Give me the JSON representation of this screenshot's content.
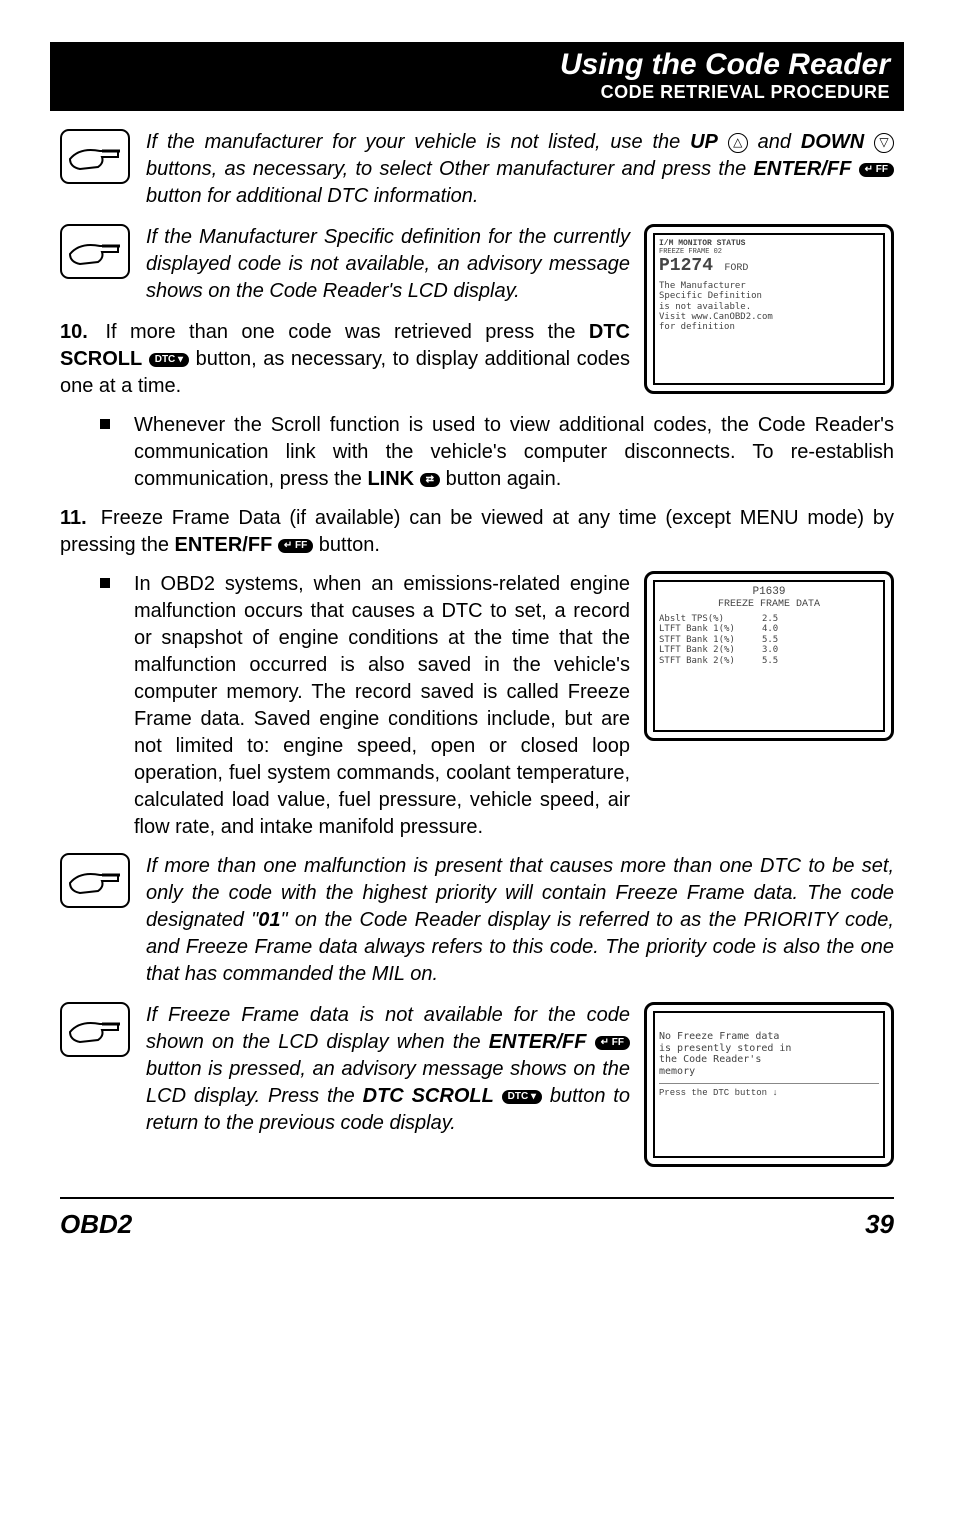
{
  "header": {
    "title": "Using the Code Reader",
    "subtitle": "CODE RETRIEVAL PROCEDURE"
  },
  "note1": {
    "pre": "If the manufacturer for your vehicle is not listed, use the ",
    "up": "UP",
    "and": " and ",
    "down": "DOWN",
    "mid": " buttons, as necessary, to select Other manufacturer and press the ",
    "enter": "ENTER/FF",
    "post": " button for additional DTC information."
  },
  "note2": "If the Manufacturer Specific definition for the currently displayed code is not available, an advisory message shows on the Code Reader's LCD display.",
  "screen1": {
    "top": "I/M MONITOR STATUS",
    "code": "P1274",
    "make": "FORD",
    "frame": "FREEZE FRAME 02",
    "msg": "The Manufacturer\nSpecific Definition\nis not available.\nVisit www.CanOBD2.com\nfor definition"
  },
  "item10": {
    "num": "10.",
    "pre": "If more than one code was retrieved press the ",
    "dtc": "DTC SCROLL",
    "post": " button, as necessary, to display additional codes one at a time."
  },
  "bullet10": {
    "pre": "Whenever the Scroll function is used to view additional codes, the Code Reader's communication link with the vehicle's computer disconnects. To re-establish communication, press the ",
    "link": "LINK",
    "post": " button again."
  },
  "item11": {
    "num": "11.",
    "pre": "Freeze Frame Data (if available) can be viewed at any time (except MENU mode) by pressing the ",
    "enter": "ENTER/FF",
    "post": " button."
  },
  "screen2": {
    "code": "P1639",
    "title": "FREEZE FRAME DATA",
    "rows": "Abslt TPS(%)       2.5\nLTFT Bank 1(%)     4.0\nSTFT Bank 1(%)     5.5\nLTFT Bank 2(%)     3.0\nSTFT Bank 2(%)     5.5"
  },
  "bullet11": "In OBD2 systems, when an emissions-related engine malfunction occurs that causes a DTC to set, a record or snapshot of engine conditions at the time that the malfunction occurred is also saved in the vehicle's computer memory. The record saved is called Freeze Frame data. Saved engine conditions include, but are not limited to: engine speed, open or closed loop operation, fuel system commands, coolant temperature, calculated load value, fuel pressure, vehicle speed, air flow rate, and intake manifold pressure.",
  "note3": {
    "pre": "If more than one malfunction is present that causes more than one DTC to be set, only the code with the highest priority will contain Freeze Frame data. The code designated \"",
    "code01": "01",
    "post": "\" on the Code Reader display is referred to as the PRIORITY code, and Freeze Frame data always refers to this code. The priority code is also the one that has commanded the MIL on."
  },
  "screen3": {
    "msg": "No Freeze Frame data\nis presently stored in\nthe Code Reader's\nmemory",
    "hint": "Press the DTC button ↓"
  },
  "note4": {
    "pre": "If Freeze Frame data is not available for the code shown on the LCD display when the ",
    "enter": "ENTER/FF",
    "mid": " button is pressed, an advisory message shows on the LCD display. Press the ",
    "dtc": "DTC SCROLL",
    "post": " button to return to the previous code display."
  },
  "footer": {
    "left": "OBD2",
    "right": "39"
  },
  "icons": {
    "up": "△",
    "down": "▽",
    "enterff_btn": "↵ FF",
    "dtc_btn": "DTC ▾",
    "link_btn": "⇄"
  }
}
